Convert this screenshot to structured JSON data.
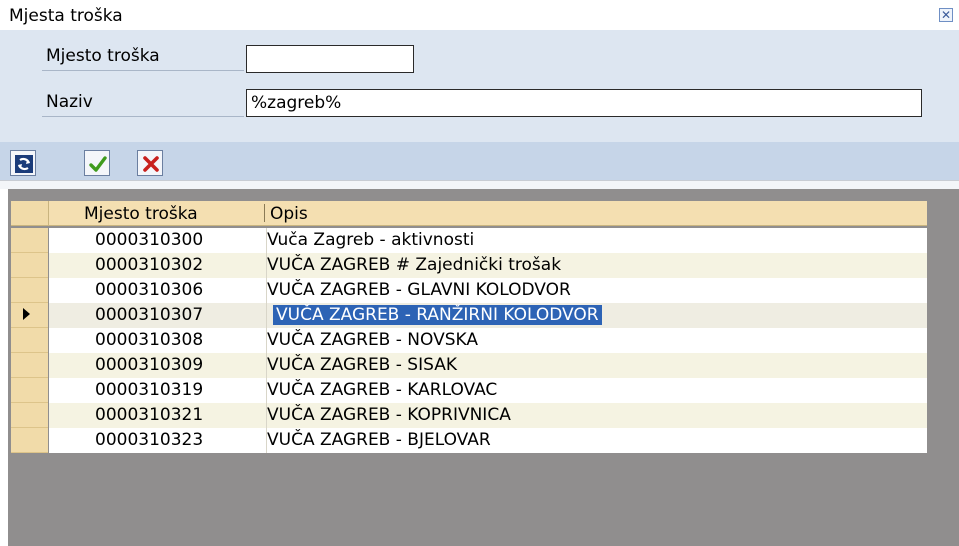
{
  "dialog": {
    "title": "Mjesta troška"
  },
  "fields": {
    "mjesto_label": "Mjesto troška",
    "mjesto_value": "",
    "naziv_label": "Naziv",
    "naziv_value": "%zagreb%"
  },
  "toolbar": {
    "refresh_icon": "refresh-icon",
    "accept_icon": "checkmark-icon",
    "cancel_icon": "cross-icon"
  },
  "table": {
    "columns": [
      "Mjesto troška",
      "Opis"
    ],
    "selected_index": 3,
    "rows": [
      {
        "kod": "0000310300",
        "opis": "Vuča Zagreb - aktivnosti"
      },
      {
        "kod": "0000310302",
        "opis": "VUČA ZAGREB # Zajednički trošak"
      },
      {
        "kod": "0000310306",
        "opis": "VUČA ZAGREB - GLAVNI KOLODVOR"
      },
      {
        "kod": "0000310307",
        "opis": "VUČA ZAGREB - RANŽIRNI KOLODVOR"
      },
      {
        "kod": "0000310308",
        "opis": "VUČA ZAGREB - NOVSKA"
      },
      {
        "kod": "0000310309",
        "opis": "VUČA ZAGREB - SISAK"
      },
      {
        "kod": "0000310319",
        "opis": "VUČA ZAGREB - KARLOVAC"
      },
      {
        "kod": "0000310321",
        "opis": "VUČA ZAGREB - KOPRIVNICA"
      },
      {
        "kod": "0000310323",
        "opis": "VUČA ZAGREB - BJELOVAR"
      }
    ]
  },
  "colors": {
    "accent": "#2d63b5",
    "header_bg": "#f4dfb1",
    "selection_bg": "#dde6f1"
  }
}
